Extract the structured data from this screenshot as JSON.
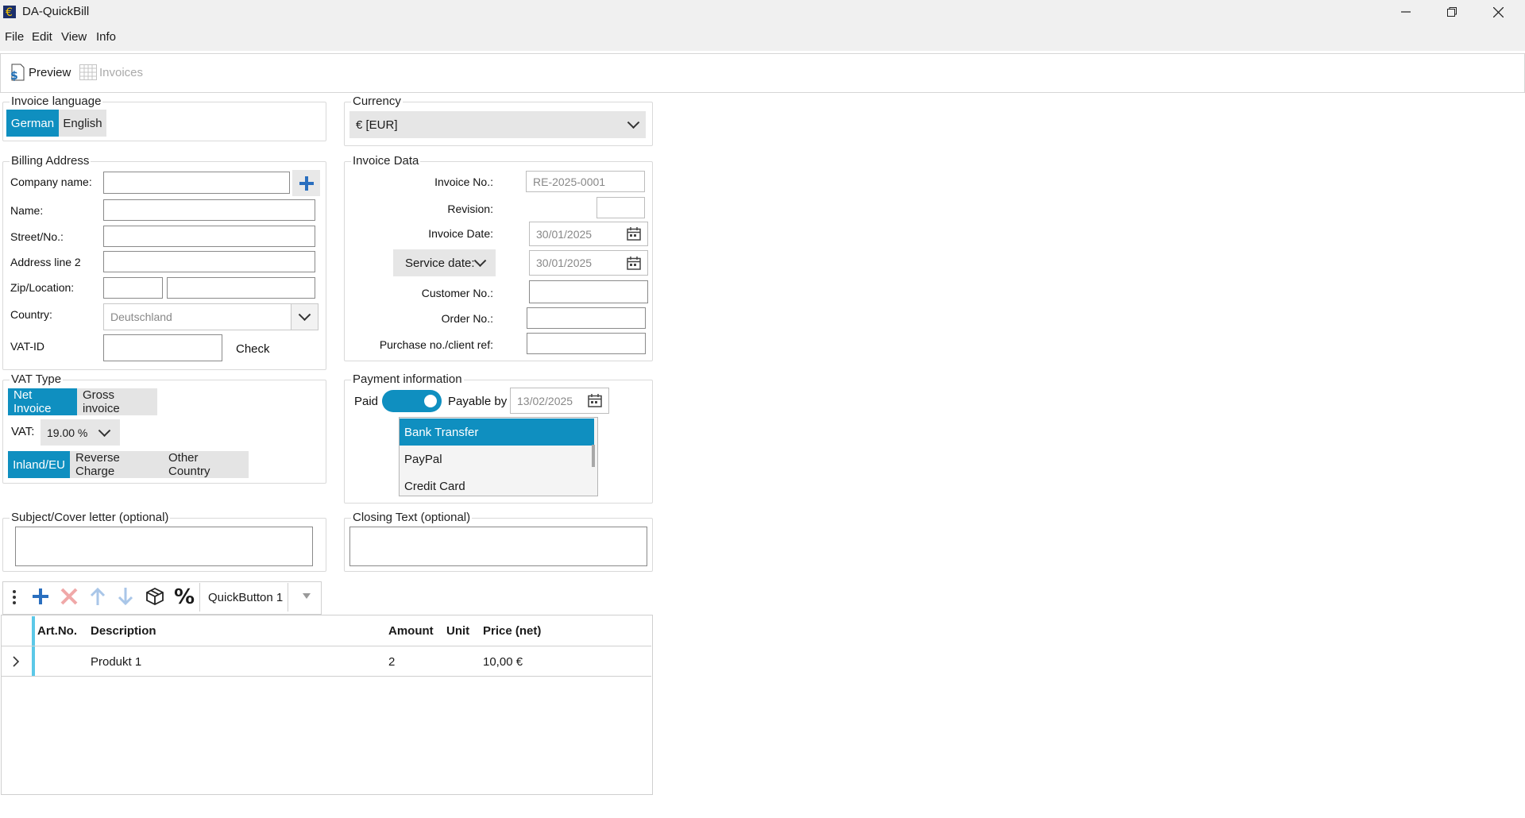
{
  "window": {
    "title": "DA-QuickBill"
  },
  "menu": [
    "File",
    "Edit",
    "View",
    "Info"
  ],
  "toolbar": {
    "preview": "Preview",
    "invoices": "Invoices"
  },
  "language": {
    "legend": "Invoice language",
    "options": [
      "German",
      "English"
    ],
    "selected": "German"
  },
  "currency": {
    "legend": "Currency",
    "value": "€ [EUR]"
  },
  "billing": {
    "legend": "Billing Address",
    "company_label": "Company name:",
    "name_label": "Name:",
    "street_label": "Street/No.:",
    "address2_label": "Address line 2",
    "zip_label": "Zip/Location:",
    "country_label": "Country:",
    "country_value": "Deutschland",
    "vat_label": "VAT-ID",
    "check_label": "Check"
  },
  "invoice_data": {
    "legend": "Invoice Data",
    "invoice_no_label": "Invoice No.:",
    "invoice_no_value": "RE-2025-0001",
    "revision_label": "Revision:",
    "invoice_date_label": "Invoice Date:",
    "invoice_date_value": "30/01/2025",
    "service_date_label": "Service date:",
    "service_date_value": "30/01/2025",
    "customer_no_label": "Customer No.:",
    "order_no_label": "Order No.:",
    "purchase_label": "Purchase no./client ref:"
  },
  "vat_type": {
    "legend": "VAT Type",
    "modes": [
      "Net Invoice",
      "Gross invoice"
    ],
    "mode_selected": "Net Invoice",
    "vat_label": "VAT:",
    "vat_value": "19.00 %",
    "regions": [
      "Inland/EU",
      "Reverse Charge",
      "Other Country"
    ],
    "region_selected": "Inland/EU"
  },
  "payment": {
    "legend": "Payment information",
    "paid_label": "Paid",
    "paid_on": true,
    "payable_label": "Payable by",
    "payable_date": "13/02/2025",
    "methods": [
      "Bank Transfer",
      "PayPal",
      "Credit Card"
    ],
    "method_selected": "Bank Transfer"
  },
  "subject": {
    "legend": "Subject/Cover letter (optional)"
  },
  "closing": {
    "legend": "Closing Text  (optional)"
  },
  "items_toolbar": {
    "quickbutton": "QuickButton 1"
  },
  "grid": {
    "headers": [
      "Art.No.",
      "Description",
      "Amount",
      "Unit",
      "Price (net)"
    ],
    "rows": [
      {
        "artno": "",
        "description": "Produkt 1",
        "amount": "2",
        "unit": "",
        "price": "10,00 €"
      }
    ]
  },
  "colors": {
    "accent": "#0f8fc0",
    "grid_marker": "#5bc8e8",
    "plus_blue": "#2a6fbf",
    "delete_red": "#f0a0a0"
  }
}
